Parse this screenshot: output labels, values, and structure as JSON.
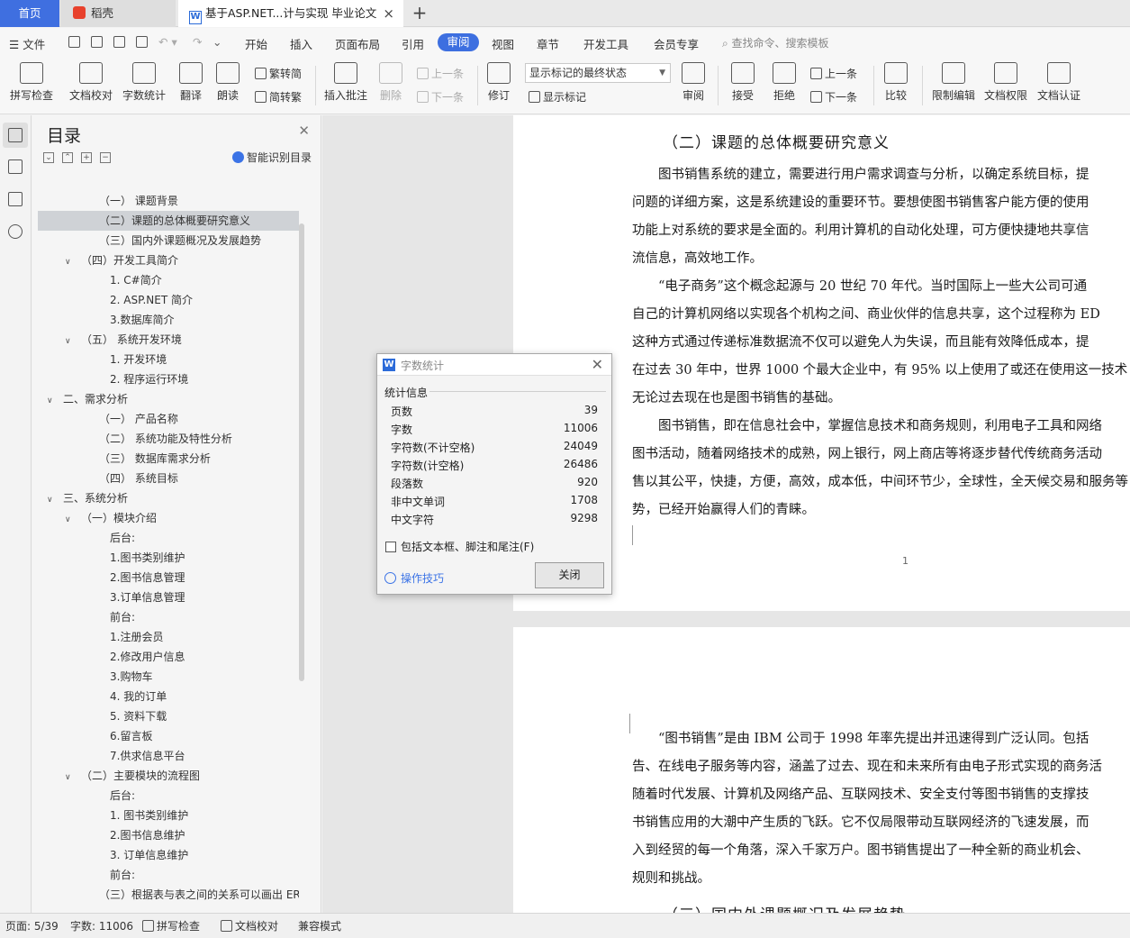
{
  "tabs": {
    "home": "首页",
    "daoke": "稻壳",
    "doc": "基于ASP.NET...计与实现 毕业论文",
    "close": "×",
    "add": "+"
  },
  "menubar": {
    "file": "文件",
    "items": [
      "开始",
      "插入",
      "页面布局",
      "引用",
      "审阅",
      "视图",
      "章节",
      "开发工具",
      "会员专享"
    ],
    "active": "审阅",
    "search": "查找命令、搜索模板"
  },
  "ribbon": {
    "spell": "拼写检查",
    "proof": "文档校对",
    "wordcount": "字数统计",
    "translate": "翻译",
    "read": "朗读",
    "trad": "繁转简",
    "simp": "简转繁",
    "comment": "插入批注",
    "delete": "删除",
    "prev": "上一条",
    "next": "下一条",
    "revise": "修订",
    "markup_state": "显示标记的最终状态",
    "show_markup": "显示标记",
    "review": "审阅",
    "accept": "接受",
    "reject": "拒绝",
    "prev2": "上一条",
    "next2": "下一条",
    "compare": "比较",
    "restrict": "限制编辑",
    "perm": "文档权限",
    "auth": "文档认证"
  },
  "toc": {
    "title": "目录",
    "smart": "智能识别目录",
    "items": [
      {
        "text": "（一）  课题背景",
        "indent": 2,
        "chev": ""
      },
      {
        "text": "（二）课题的总体概要研究意义",
        "indent": 2,
        "chev": "",
        "selected": true
      },
      {
        "text": "（三）国内外课题概况及发展趋势",
        "indent": 2,
        "chev": ""
      },
      {
        "text": "（四）开发工具简介",
        "indent": 1,
        "chev": "v"
      },
      {
        "text": "1. C#简介",
        "indent": 3,
        "chev": ""
      },
      {
        "text": "2.    ASP.NET 简介",
        "indent": 3,
        "chev": ""
      },
      {
        "text": "3.数据库简介",
        "indent": 3,
        "chev": ""
      },
      {
        "text": "（五）  系统开发环境",
        "indent": 1,
        "chev": "v"
      },
      {
        "text": "1. 开发环境",
        "indent": 3,
        "chev": ""
      },
      {
        "text": "2. 程序运行环境",
        "indent": 3,
        "chev": ""
      },
      {
        "text": "二、需求分析",
        "indent": 0,
        "chev": "v"
      },
      {
        "text": "（一）  产品名称",
        "indent": 2,
        "chev": ""
      },
      {
        "text": "（二）  系统功能及特性分析",
        "indent": 2,
        "chev": ""
      },
      {
        "text": "（三）  数据库需求分析",
        "indent": 2,
        "chev": ""
      },
      {
        "text": "（四）  系统目标",
        "indent": 2,
        "chev": ""
      },
      {
        "text": "三、系统分析",
        "indent": 0,
        "chev": "v"
      },
      {
        "text": "（一）模块介绍",
        "indent": 1,
        "chev": "v"
      },
      {
        "text": "后台:",
        "indent": 3,
        "chev": ""
      },
      {
        "text": "1.图书类别维护",
        "indent": 3,
        "chev": ""
      },
      {
        "text": "2.图书信息管理",
        "indent": 3,
        "chev": ""
      },
      {
        "text": "3.订单信息管理",
        "indent": 3,
        "chev": ""
      },
      {
        "text": "前台:",
        "indent": 3,
        "chev": ""
      },
      {
        "text": "1.注册会员",
        "indent": 3,
        "chev": ""
      },
      {
        "text": "2.修改用户信息",
        "indent": 3,
        "chev": ""
      },
      {
        "text": "3.购物车",
        "indent": 3,
        "chev": ""
      },
      {
        "text": "4. 我的订单",
        "indent": 3,
        "chev": ""
      },
      {
        "text": "5. 资料下载",
        "indent": 3,
        "chev": ""
      },
      {
        "text": "6.留言板",
        "indent": 3,
        "chev": ""
      },
      {
        "text": "7.供求信息平台",
        "indent": 3,
        "chev": ""
      },
      {
        "text": "（二）主要模块的流程图",
        "indent": 1,
        "chev": "v"
      },
      {
        "text": "后台:",
        "indent": 3,
        "chev": ""
      },
      {
        "text": "1. 图书类别维护",
        "indent": 3,
        "chev": ""
      },
      {
        "text": "2.图书信息维护",
        "indent": 3,
        "chev": ""
      },
      {
        "text": "3. 订单信息维护",
        "indent": 3,
        "chev": ""
      },
      {
        "text": "前台:",
        "indent": 3,
        "chev": ""
      },
      {
        "text": "（三）根据表与表之间的关系可以画出 ER ...",
        "indent": 2,
        "chev": ""
      }
    ]
  },
  "document": {
    "heading": "（二）课题的总体概要研究意义",
    "page1_lines": [
      "　　图书销售系统的建立，需要进行用户需求调查与分析，以确定系统目标，提",
      "问题的详细方案，这是系统建设的重要环节。要想使图书销售客户能方便的使用",
      "功能上对系统的要求是全面的。利用计算机的自动化处理，可方便快捷地共享信",
      "流信息，高效地工作。",
      "　　“电子商务”这个概念起源与 20 世纪 70 年代。当时国际上一些大公司可通",
      "自己的计算机网络以实现各个机构之间、商业伙伴的信息共享，这个过程称为 ED",
      "这种方式通过传递标准数据流不仅可以避免人为失误，而且能有效降低成本，提",
      "在过去 30 年中，世界 1000 个最大企业中，有 95% 以上使用了或还在使用这一技术",
      "无论过去现在也是图书销售的基础。",
      "　　图书销售，即在信息社会中，掌握信息技术和商务规则，利用电子工具和网络",
      "图书活动，随着网络技术的成熟，网上银行，网上商店等将逐步替代传统商务活动",
      "售以其公平，快捷，方便，高效，成本低，中间环节少，全球性，全天候交易和服务等",
      "势，已经开始赢得人们的青睐。"
    ],
    "page_number": "1",
    "page2_lines": [
      "　　“图书销售”是由 IBM 公司于 1998 年率先提出并迅速得到广泛认同。包括",
      "告、在线电子服务等内容，涵盖了过去、现在和未来所有由电子形式实现的商务活",
      "随着时代发展、计算机及网络产品、互联网技术、安全支付等图书销售的支撑技",
      "书销售应用的大潮中产生质的飞跃。它不仅局限带动互联网经济的飞速发展，而",
      "入到经贸的每一个角落，深入千家万户。图书销售提出了一种全新的商业机会、",
      "规则和挑战。"
    ],
    "next_heading": "（三）国内外课题概况及发展趋势"
  },
  "dialog": {
    "title": "字数统计",
    "section": "统计信息",
    "stats": [
      {
        "label": "页数",
        "value": "39"
      },
      {
        "label": "字数",
        "value": "11006"
      },
      {
        "label": "字符数(不计空格)",
        "value": "24049"
      },
      {
        "label": "字符数(计空格)",
        "value": "26486"
      },
      {
        "label": "段落数",
        "value": "920"
      },
      {
        "label": "非中文单词",
        "value": "1708"
      },
      {
        "label": "中文字符",
        "value": "9298"
      }
    ],
    "checkbox": "包括文本框、脚注和尾注(F)",
    "tips": "操作技巧",
    "close": "关闭"
  },
  "status": {
    "page": "页面: 5/39",
    "words": "字数: 11006",
    "spell": "拼写检查",
    "proof": "文档校对",
    "compat": "兼容模式"
  },
  "colors": {
    "accent": "#3d6fe0",
    "selected_toc": "#cfd2d6"
  }
}
